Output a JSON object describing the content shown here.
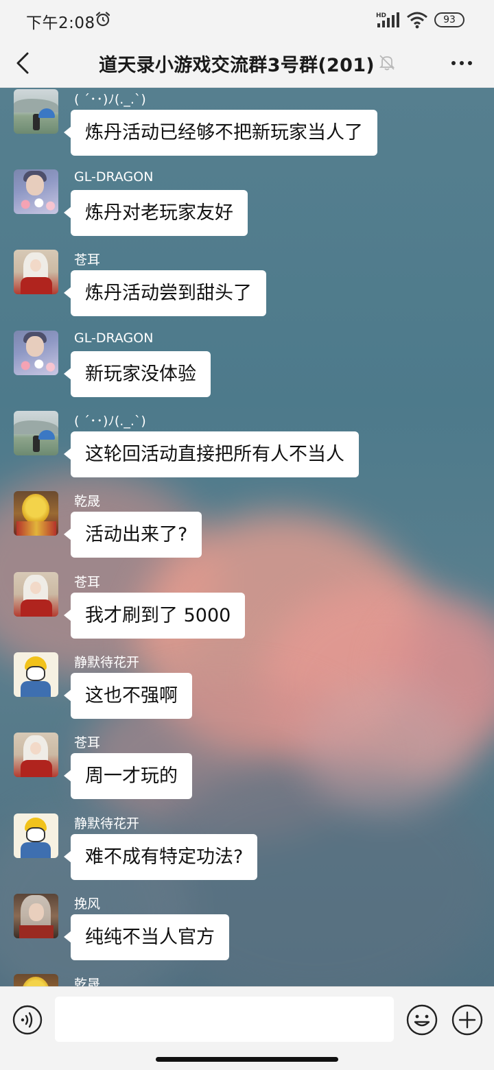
{
  "status_bar": {
    "time": "下午2:08",
    "battery": "93",
    "network_label": "HD"
  },
  "header": {
    "title": "道天录小游戏交流群3号群(201)"
  },
  "messages": [
    {
      "sender": "( ´･･)ﾉ(._.`)",
      "text": "炼丹活动已经够不把新玩家当人了",
      "avatar": "landscape"
    },
    {
      "sender": "GL-DRAGON",
      "text": "炼丹对老玩家友好",
      "avatar": "dragon"
    },
    {
      "sender": "苍耳",
      "text": "炼丹活动尝到甜头了",
      "avatar": "red"
    },
    {
      "sender": "GL-DRAGON",
      "text": "新玩家没体验",
      "avatar": "dragon"
    },
    {
      "sender": "( ´･･)ﾉ(._.`)",
      "text": "这轮回活动直接把所有人不当人",
      "avatar": "landscape"
    },
    {
      "sender": "乾晟",
      "text": "活动出来了?",
      "avatar": "gold"
    },
    {
      "sender": "苍耳",
      "text": "我才刷到了 5000",
      "avatar": "red"
    },
    {
      "sender": "静默待花开",
      "text": "这也不强啊",
      "avatar": "cartoon"
    },
    {
      "sender": "苍耳",
      "text": "周一才玩的",
      "avatar": "red"
    },
    {
      "sender": "静默待花开",
      "text": "难不成有特定功法?",
      "avatar": "cartoon"
    },
    {
      "sender": "挽风",
      "text": "纯纯不当人官方",
      "avatar": "wind"
    },
    {
      "sender": "乾晟",
      "text": "",
      "avatar": "gold"
    }
  ],
  "input_bar": {
    "placeholder": "",
    "value": ""
  },
  "icons": {
    "back": "chevron-left-icon",
    "mute": "bell-off-icon",
    "more": "more-dots-icon",
    "voice": "voice-icon",
    "emoji": "smiley-icon",
    "add": "plus-circle-icon",
    "alarm": "alarm-icon",
    "signal": "signal-icon",
    "wifi": "wifi-icon"
  },
  "colors": {
    "bubble": "#ffffff",
    "bar_background": "#f3f3f3",
    "sender_name": "#ffffff"
  }
}
